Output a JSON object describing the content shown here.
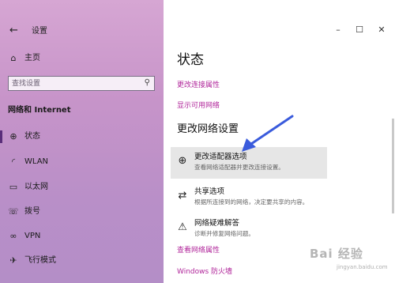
{
  "window": {
    "title": "设置"
  },
  "sidebar": {
    "home_label": "主页",
    "search_placeholder": "查找设置",
    "section_title": "网络和 Internet",
    "items": [
      {
        "label": "状态",
        "icon": "status-icon"
      },
      {
        "label": "WLAN",
        "icon": "wifi-icon"
      },
      {
        "label": "以太网",
        "icon": "ethernet-icon"
      },
      {
        "label": "拨号",
        "icon": "dialup-icon"
      },
      {
        "label": "VPN",
        "icon": "vpn-icon"
      },
      {
        "label": "飞行模式",
        "icon": "airplane-icon"
      }
    ]
  },
  "main": {
    "title": "状态",
    "links_top": [
      "更改连接属性",
      "显示可用网络"
    ],
    "subheading": "更改网络设置",
    "options": [
      {
        "title": "更改适配器选项",
        "desc": "查看网络适配器并更改连接设置。",
        "icon": "adapter-icon"
      },
      {
        "title": "共享选项",
        "desc": "根据所连接到的网络，决定要共享的内容。",
        "icon": "sharing-icon"
      },
      {
        "title": "网络疑难解答",
        "desc": "诊断并修复网络问题。",
        "icon": "warning-icon"
      }
    ],
    "links_bottom": [
      "查看网络属性",
      "Windows 防火墙"
    ]
  },
  "watermark": {
    "brand": "Bai 经验",
    "url": "jingyan.baidu.com"
  },
  "colors": {
    "accent": "#b0259a",
    "sidebar": "#c794c9",
    "arrow": "#3a5bdc",
    "highlight": "#e6e6e6"
  }
}
